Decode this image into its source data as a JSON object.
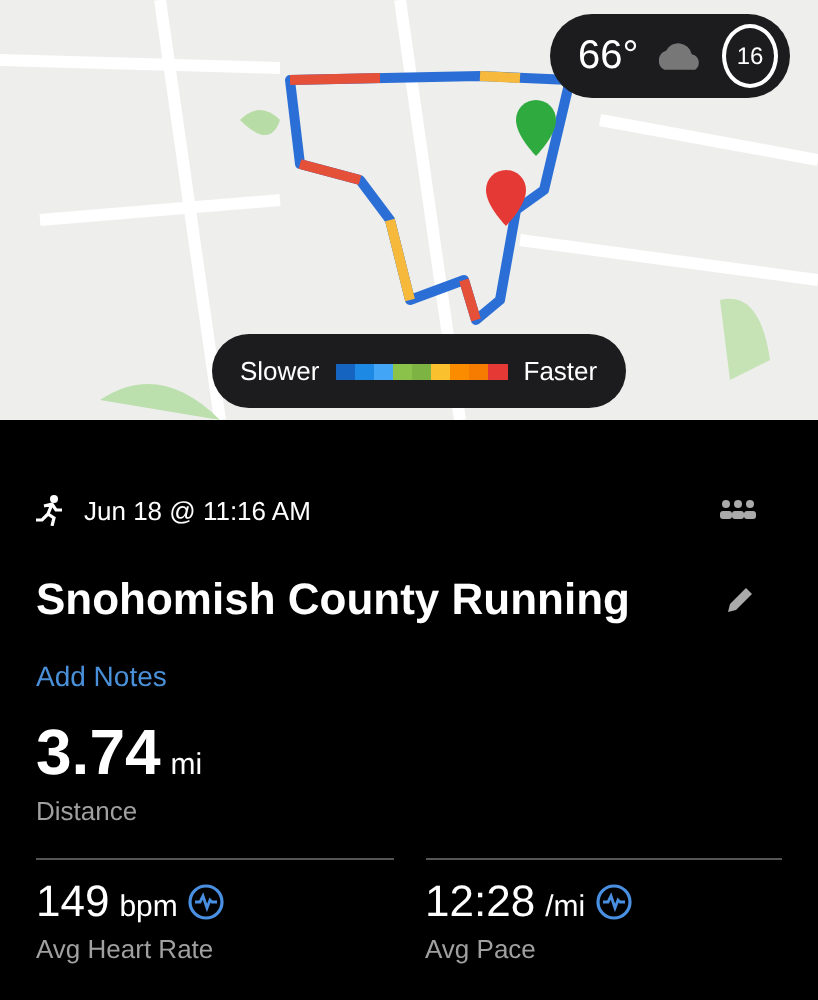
{
  "map": {
    "kind": "picture",
    "weather": {
      "temperature": "66°",
      "wind_speed": "16"
    },
    "pace_legend": {
      "slow_label": "Slower",
      "fast_label": "Faster"
    }
  },
  "activity": {
    "date_time": "Jun 18 @ 11:16 AM",
    "title": "Snohomish County Running",
    "add_notes": "Add Notes"
  },
  "distance": {
    "value": "3.74",
    "unit": "mi",
    "label": "Distance"
  },
  "stats": [
    {
      "value": "149",
      "unit": "bpm",
      "label": "Avg Heart Rate"
    },
    {
      "value": "12:28",
      "unit": "/mi",
      "label": "Avg Pace"
    }
  ]
}
